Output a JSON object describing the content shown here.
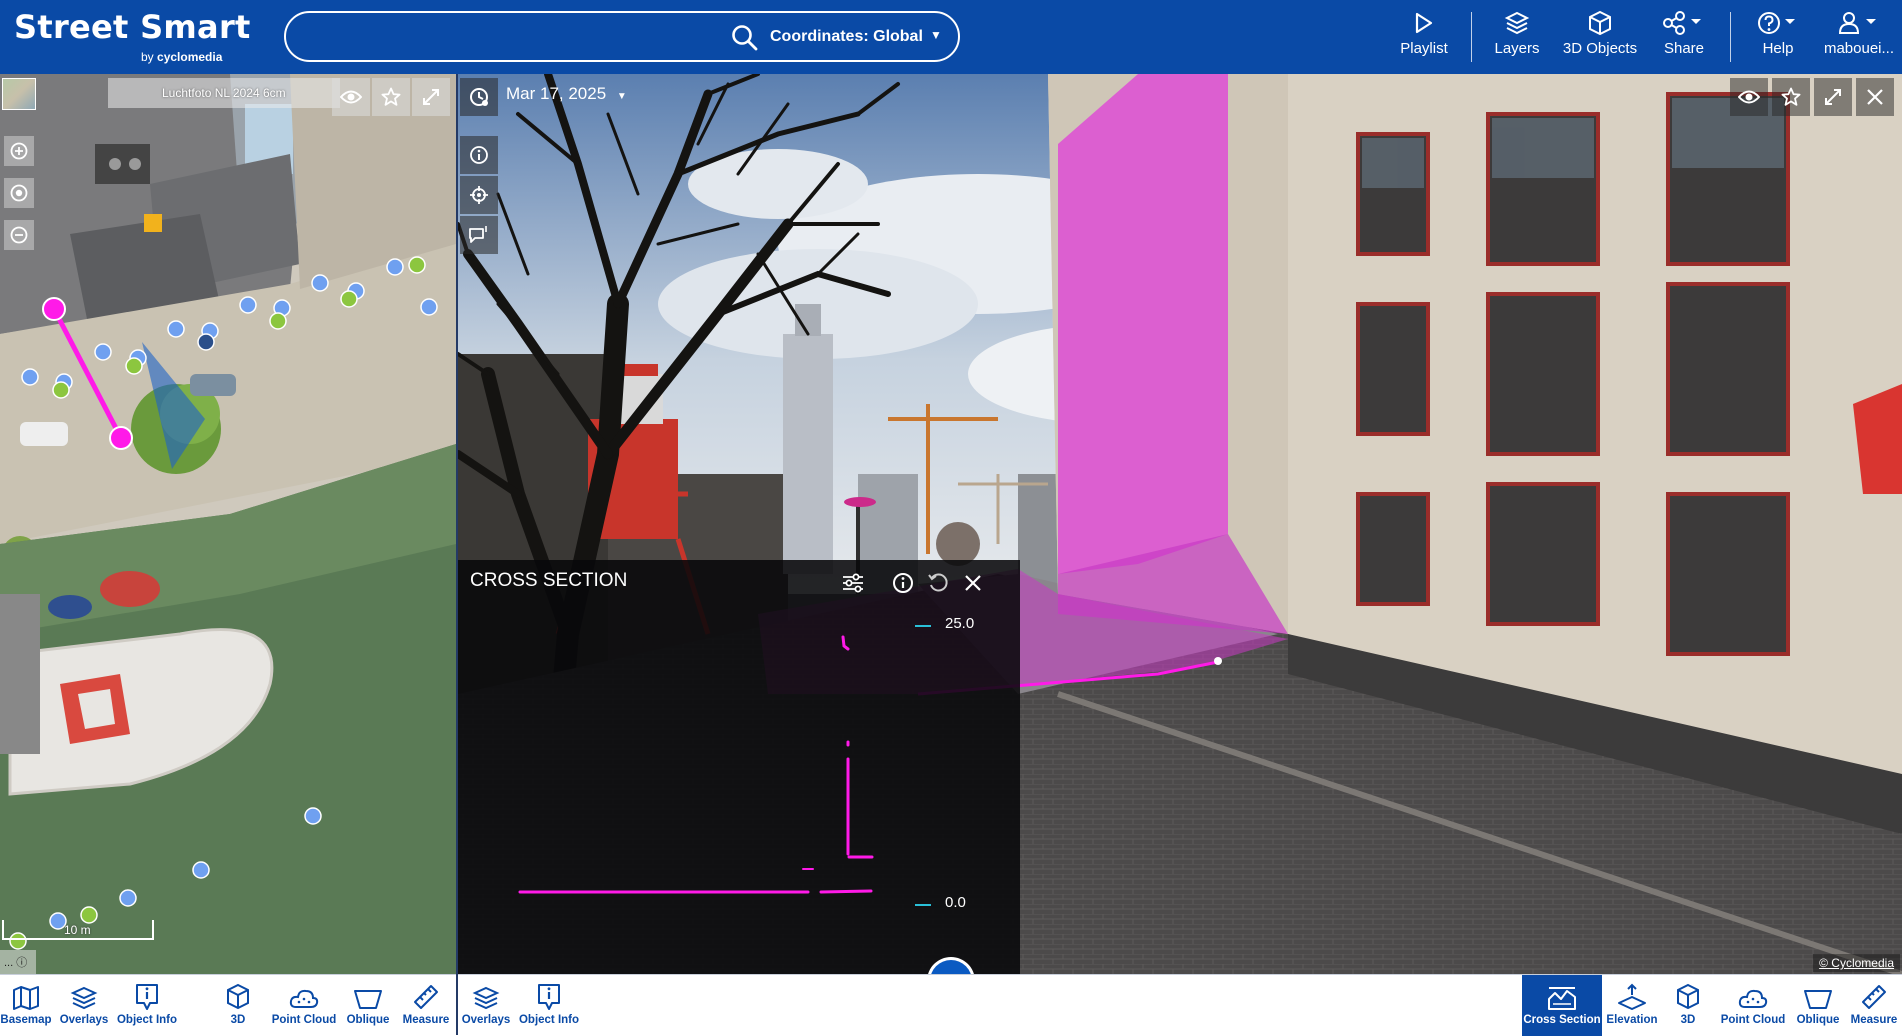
{
  "app": {
    "title": "Street Smart",
    "byline_prefix": "by",
    "byline_brand": "cyclomedia"
  },
  "search": {
    "placeholder": "",
    "coordinates_label": "Coordinates: Global",
    "icon": "search-icon"
  },
  "topnav": {
    "playlist": "Playlist",
    "layers": "Layers",
    "objects3d": "3D Objects",
    "share": "Share",
    "help": "Help",
    "user": "mabouei..."
  },
  "map": {
    "layer_title": "Luchtfoto NL 2024 6cm",
    "scale_label": "10 m",
    "attribution": "... ⓘ"
  },
  "panorama": {
    "date": "Mar 17, 2025",
    "attribution": "© Cyclomedia"
  },
  "cross_section": {
    "title": "CROSS SECTION",
    "y_max": "25.0",
    "y_min": "0.0"
  },
  "left_toolbar": [
    {
      "label": "Basemap",
      "icon": "basemap-icon"
    },
    {
      "label": "Overlays",
      "icon": "overlays-icon"
    },
    {
      "label": "Object Info",
      "icon": "object-info-icon"
    },
    {
      "label": "3D",
      "icon": "3d-icon"
    },
    {
      "label": "Point Cloud",
      "icon": "point-cloud-icon"
    },
    {
      "label": "Oblique",
      "icon": "oblique-icon"
    },
    {
      "label": "Measure",
      "icon": "measure-icon"
    }
  ],
  "mid_toolbar": [
    {
      "label": "Overlays",
      "icon": "overlays-icon"
    },
    {
      "label": "Object Info",
      "icon": "object-info-icon"
    }
  ],
  "right_toolbar": [
    {
      "label": "Cross Section",
      "icon": "cross-section-icon",
      "active": true
    },
    {
      "label": "Elevation",
      "icon": "elevation-icon"
    },
    {
      "label": "3D",
      "icon": "3d-icon"
    },
    {
      "label": "Point Cloud",
      "icon": "point-cloud-icon"
    },
    {
      "label": "Oblique",
      "icon": "oblique-icon"
    },
    {
      "label": "Measure",
      "icon": "measure-icon"
    }
  ],
  "colors": {
    "brand_blue": "#0a4aa6",
    "measure_magenta": "#ff00e6",
    "dot_blue": "#6fa0f0",
    "dot_green": "#8cc63f"
  }
}
